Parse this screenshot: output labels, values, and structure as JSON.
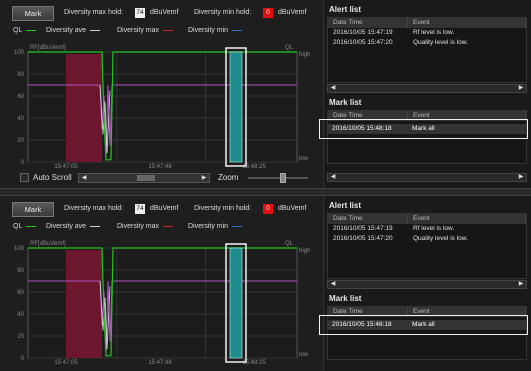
{
  "colors": {
    "ql": "#22c522",
    "diversity_ave": "#d0d0d0",
    "diversity_max": "#d02020",
    "diversity_min": "#3070c0",
    "mark_band": "#1f8a8a",
    "fill_region": "#7a1630",
    "purple": "#b050c0"
  },
  "toolbar": {
    "mark_label": "Mark",
    "max_hold_label": "Diversity max hold:",
    "max_hold_value": "74",
    "max_hold_unit": "dBuVemf",
    "min_hold_label": "Diversity min hold:",
    "min_hold_value": "0",
    "min_hold_unit": "dBuVemf"
  },
  "legend": {
    "ql": "QL",
    "diversity_ave": "Diversity ave",
    "diversity_max": "Diversity max",
    "diversity_min": "Diversity min"
  },
  "chart": {
    "left_axis_title": "RF[dBuVemf]",
    "right_axis_title": "QL",
    "right_axis_top": "high",
    "right_axis_bottom": "low",
    "y_ticks": [
      "100",
      "80",
      "60",
      "40",
      "20",
      "0"
    ],
    "x_ticks": [
      "15:47:05",
      "15:47:48",
      "15:48:25"
    ]
  },
  "bottom": {
    "auto_scroll": "Auto Scroll",
    "zoom": "Zoom"
  },
  "alert_list": {
    "title": "Alert list",
    "columns": [
      "Date Time",
      "Event"
    ],
    "rows": [
      {
        "time": "2016/10/05  15:47:19",
        "event": "Rf level is low."
      },
      {
        "time": "2016/10/05  15:47:20",
        "event": "Quality level is low."
      }
    ]
  },
  "mark_list": {
    "title": "Mark list",
    "columns": [
      "Date Time",
      "Event"
    ],
    "row": {
      "time": "2016/10/05 15:48:18",
      "event": "Mark all"
    }
  },
  "chart_data": {
    "type": "line",
    "y_left_label": "RF[dBuVemf]",
    "y_right_label": "QL",
    "ylim": [
      0,
      100
    ],
    "x_ticks": [
      "15:47:05",
      "15:47:48",
      "15:48:25"
    ],
    "series": [
      {
        "name": "QL",
        "values": [
          100,
          100,
          100,
          100,
          0,
          100,
          100,
          100,
          100,
          100
        ]
      },
      {
        "name": "Diversity ave",
        "values": [
          70,
          70,
          70,
          70,
          10,
          70,
          70,
          70,
          70,
          70
        ]
      }
    ]
  }
}
